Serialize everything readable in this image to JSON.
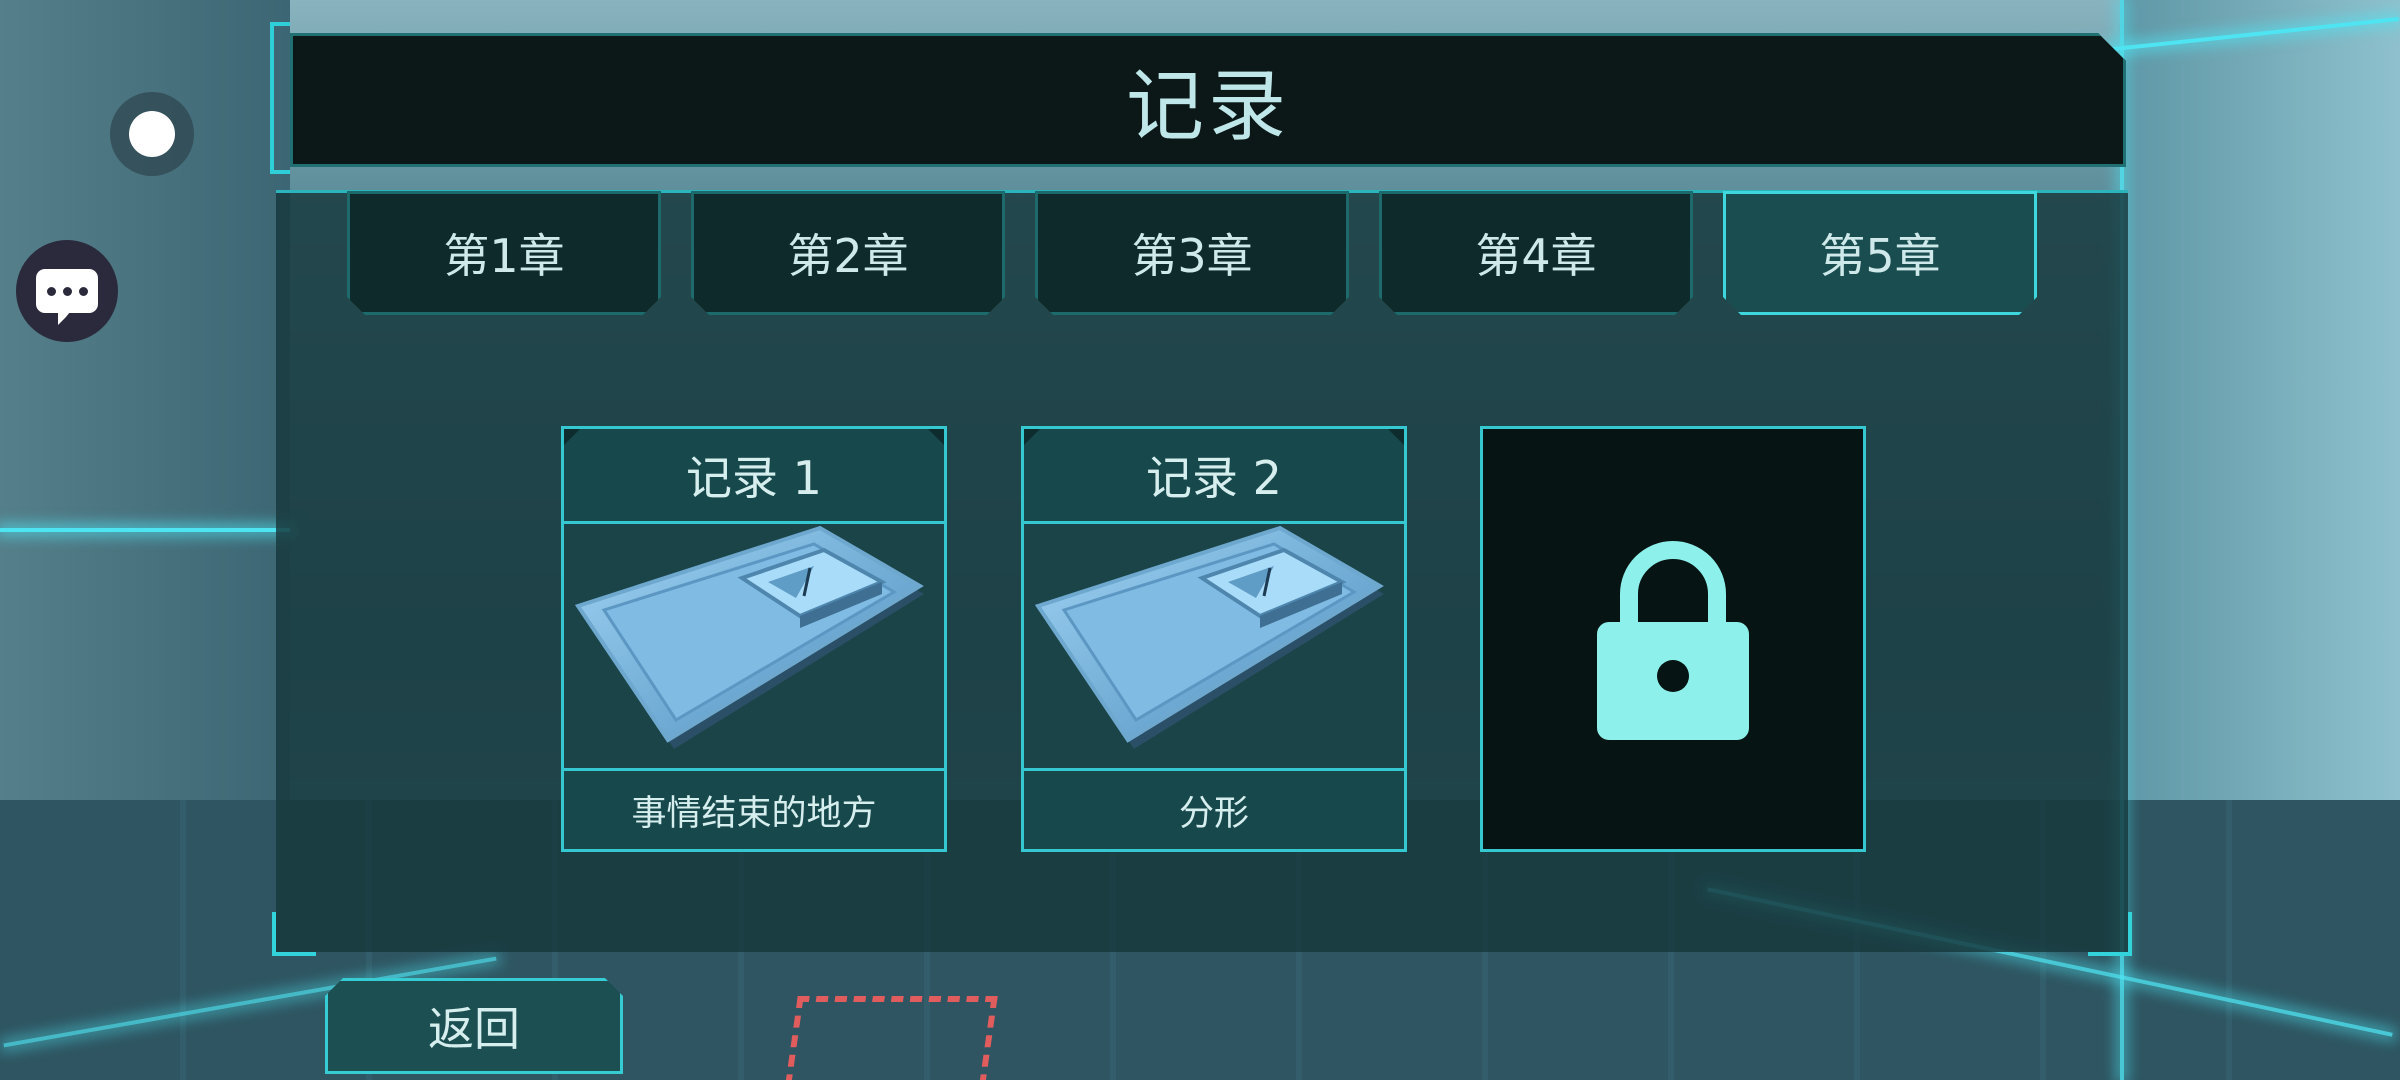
{
  "header": {
    "title": "记录"
  },
  "tabs": [
    {
      "label": "第1章"
    },
    {
      "label": "第2章"
    },
    {
      "label": "第3章"
    },
    {
      "label": "第4章"
    },
    {
      "label": "第5章",
      "active": true
    }
  ],
  "records": [
    {
      "title": "记录 1",
      "caption": "事情结束的地方"
    },
    {
      "title": "记录 2",
      "caption": "分形"
    }
  ],
  "locked_record": {
    "icon": "lock-icon"
  },
  "footer": {
    "back_label": "返回"
  },
  "side_controls": {
    "record_icon": "record-dot-icon",
    "chat_icon": "chat-icon"
  },
  "colors": {
    "accent": "#35c8d0",
    "panel": "#16383c",
    "lock": "#8ef0ea",
    "title_bg": "#0b1817"
  }
}
